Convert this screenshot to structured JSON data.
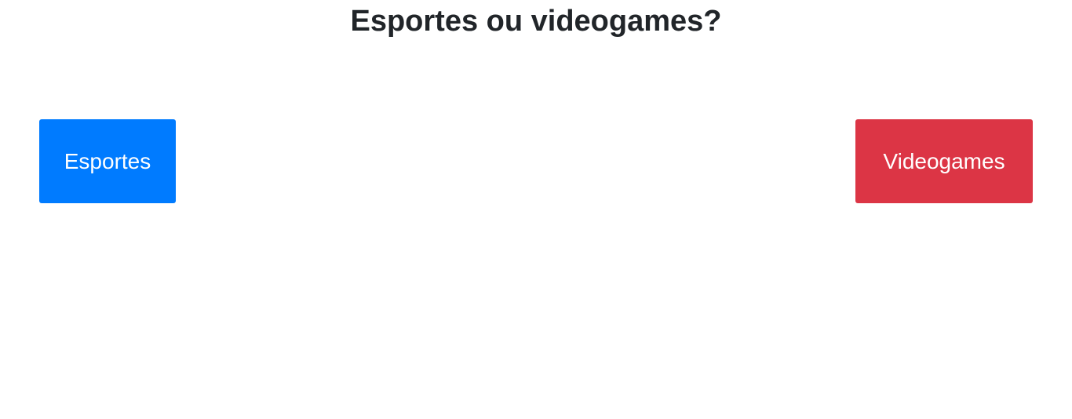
{
  "page": {
    "title": "Esportes ou videogames?"
  },
  "choices": {
    "sports": {
      "label": "Esportes",
      "color": "#007bff"
    },
    "games": {
      "label": "Videogames",
      "color": "#dc3545"
    }
  }
}
